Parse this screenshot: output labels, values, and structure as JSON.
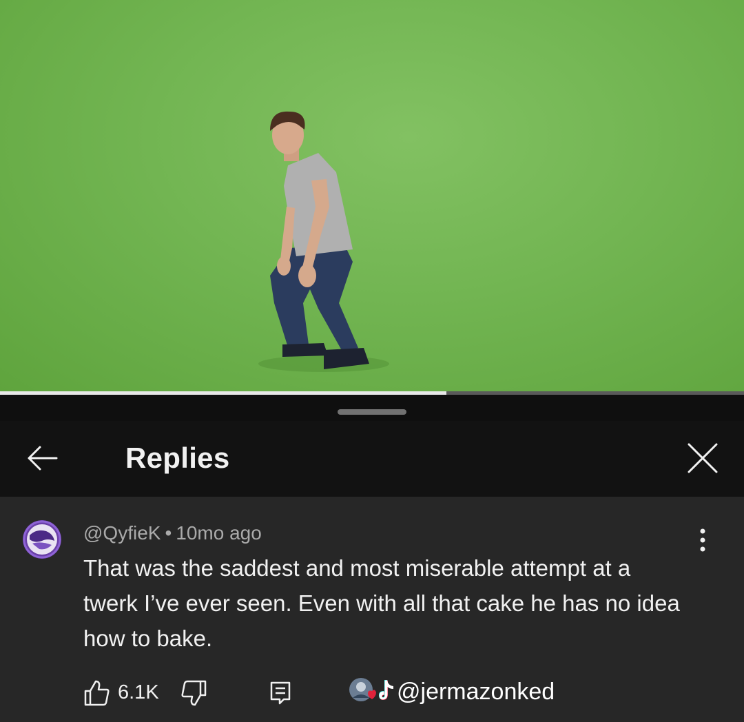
{
  "video": {
    "progress": 0.6
  },
  "header": {
    "title": "Replies"
  },
  "comment": {
    "handle": "@QyfieK",
    "separator": "•",
    "time": "10mo ago",
    "text": "That was the saddest and most miserable attempt at a twerk I’ve ever seen. Even with all that cake he has no idea how to bake.",
    "likes": "6.1K"
  },
  "watermark": {
    "handle": "@jermazonked"
  },
  "icons": {
    "back": "arrow-left-icon",
    "close": "close-icon",
    "more": "more-vert-icon",
    "like": "thumb-up-icon",
    "dislike": "thumb-down-icon",
    "reply": "reply-icon",
    "tiktok": "tiktok-icon"
  },
  "colors": {
    "sheet": "#0f0f0f",
    "header": "#121212",
    "comment_bg": "#272727",
    "secondary_text": "#aaaaaa",
    "greenscreen": "#72b552"
  }
}
